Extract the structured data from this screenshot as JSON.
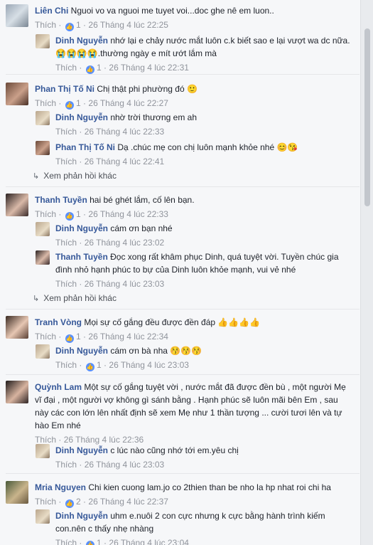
{
  "comments": [
    {
      "author": "Liên Chi",
      "text": " Nguoi vo va nguoi me tuyet voi...doc ghe nê em luon..",
      "like": "Thích",
      "likes": "1",
      "time": "26 Tháng 4 lúc 22:25",
      "reply": {
        "author": "Dinh Nguyễn",
        "text": " nhớ lại e chảy nước mắt luôn c.k biết sao e lại vượt wa dc nữa.😭😭😭😭.thường ngày e mít ướt lắm mà",
        "like": "Thích",
        "likes": "1",
        "time": "26 Tháng 4 lúc 22:31"
      }
    },
    {
      "author": "Phan Thị Tố Ni",
      "text": " Chị thật phi phường đó 🙂",
      "like": "Thích",
      "likes": "1",
      "time": "26 Tháng 4 lúc 22:27",
      "replies": [
        {
          "author": "Dinh Nguyễn",
          "text": " nhờ trời thương em ah",
          "like": "Thích",
          "time": "26 Tháng 4 lúc 22:33"
        },
        {
          "author": "Phan Thị Tố Ni",
          "text": " Dạ .chúc mẹ con chị luôn mạnh khỏe nhé 😊😘",
          "like": "Thích",
          "time": "26 Tháng 4 lúc 22:41"
        }
      ],
      "more": "Xem phản hồi khác"
    },
    {
      "author": "Thanh Tuyền",
      "text": " hai bé ghét lắm, cố lên bạn.",
      "like": "Thích",
      "likes": "1",
      "time": "26 Tháng 4 lúc 22:33",
      "replies": [
        {
          "author": "Dinh Nguyễn",
          "text": " cám ơn bạn nhé",
          "like": "Thích",
          "time": "26 Tháng 4 lúc 23:02"
        },
        {
          "author": "Thanh Tuyền",
          "text": " Đọc xong rất khâm phục Dinh, quá tuyệt vời. Tuyền chúc gia đình nhỏ hạnh phúc to bự của Dinh luôn khỏe mạnh, vui vẻ nhé",
          "like": "Thích",
          "time": "26 Tháng 4 lúc 23:03"
        }
      ],
      "more": "Xem phản hồi khác"
    },
    {
      "author": "Tranh Vòng",
      "text": " Mọi sự cố gắng đều được đền đáp 👍👍👍👍",
      "like": "Thích",
      "likes": "1",
      "time": "26 Tháng 4 lúc 22:34",
      "reply": {
        "author": "Dinh Nguyễn",
        "text": " cám ơn bà nha 😚😚😚",
        "like": "Thích",
        "likes": "1",
        "time": "26 Tháng 4 lúc 23:03"
      }
    },
    {
      "author": "Quỳnh Lam",
      "text": " Một sự cố gắng tuyệt vời , nước mắt đã được đền bù , một người Mẹ vĩ đại , một người vợ không gì sánh bằng . Hạnh phúc sẽ luôn mãi bên Em , sau này các con lớn lên nhất định sẽ xem Mẹ như 1 thần tượng ... cười tươi lên và tự hào Em nhé",
      "like": "Thích",
      "time": "26 Tháng 4 lúc 22:36",
      "reply": {
        "author": "Dinh Nguyễn",
        "text": " c lúc nào cũng nhớ tới em.yêu chị",
        "like": "Thích",
        "time": "26 Tháng 4 lúc 23:03"
      }
    },
    {
      "author": "Mria Nguyen",
      "text": " Chi kien cuong lam.jo co 2thien than be nho la hp nhat roi chi ha",
      "like": "Thích",
      "likes": "2",
      "time": "26 Tháng 4 lúc 22:37",
      "reply": {
        "author": "Dinh Nguyễn",
        "text": " uhm e.nuôi 2 con cực nhưng k cực bằng hành trình kiếm con.nên c thấy nhẹ nhàng",
        "like": "Thích",
        "likes": "1",
        "time": "26 Tháng 4 lúc 23:04"
      }
    }
  ],
  "colors": {
    "link": "#365899",
    "meta": "#90949c",
    "like_badge": "#5890ff",
    "background": "#f6f7f9"
  },
  "icons": {
    "like_badge": "thumbs-up-icon",
    "more_replies": "reply-arrow-icon"
  }
}
